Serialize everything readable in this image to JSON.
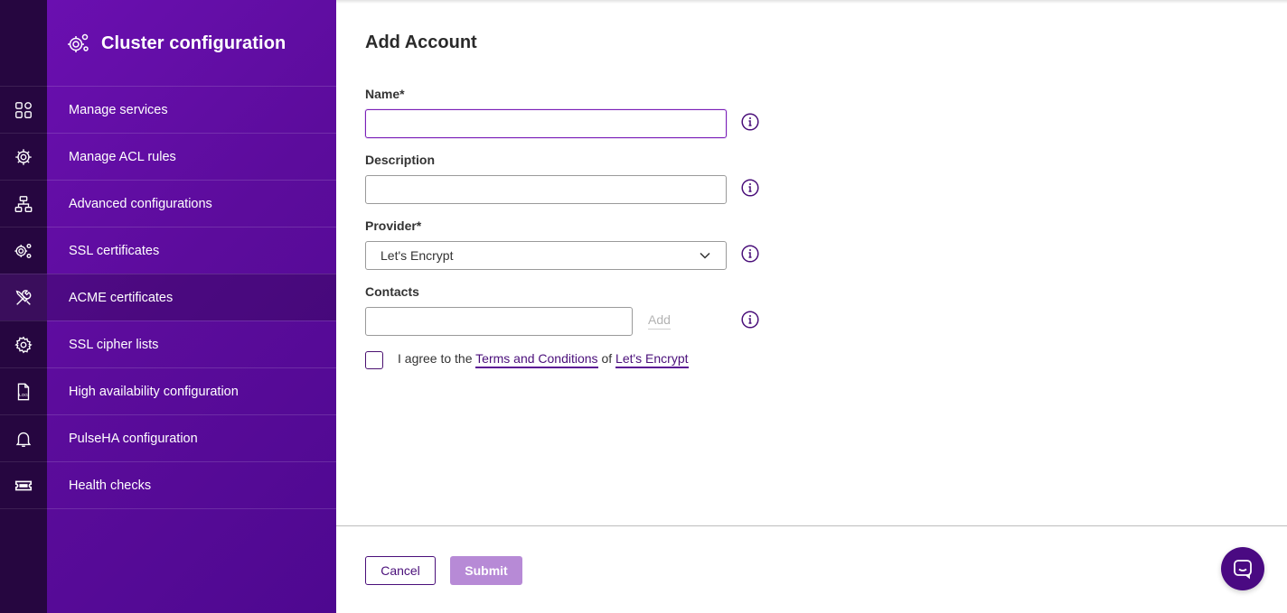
{
  "sidebar": {
    "title": "Cluster configuration",
    "items": [
      {
        "label": "Manage services",
        "icon": "grid-icon"
      },
      {
        "label": "Manage ACL rules",
        "icon": "gear-icon"
      },
      {
        "label": "Advanced configurations",
        "icon": "network-icon"
      },
      {
        "label": "SSL certificates",
        "icon": "gears-icon"
      },
      {
        "label": "ACME certificates",
        "icon": "tools-icon",
        "active": true
      },
      {
        "label": "SSL cipher lists",
        "icon": "gear-icon"
      },
      {
        "label": "High availability configuration",
        "icon": "log-file-icon"
      },
      {
        "label": "PulseHA configuration",
        "icon": "bell-icon"
      },
      {
        "label": "Health checks",
        "icon": "ticket-icon"
      }
    ]
  },
  "form": {
    "title": "Add Account",
    "name_label": "Name*",
    "name_value": "",
    "description_label": "Description",
    "description_value": "",
    "provider_label": "Provider*",
    "provider_value": "Let's Encrypt",
    "contacts_label": "Contacts",
    "contacts_value": "",
    "contacts_add": "Add",
    "agree_prefix": "I agree to the",
    "agree_terms": "Terms and Conditions",
    "agree_of": "of",
    "agree_provider": "Let's Encrypt"
  },
  "footer": {
    "cancel_label": "Cancel",
    "submit_label": "Submit"
  },
  "colors": {
    "accent": "#4a0f7a",
    "sidebar": "#5c0c9c",
    "rail": "#260640",
    "submit_disabled": "#b78ad6"
  }
}
